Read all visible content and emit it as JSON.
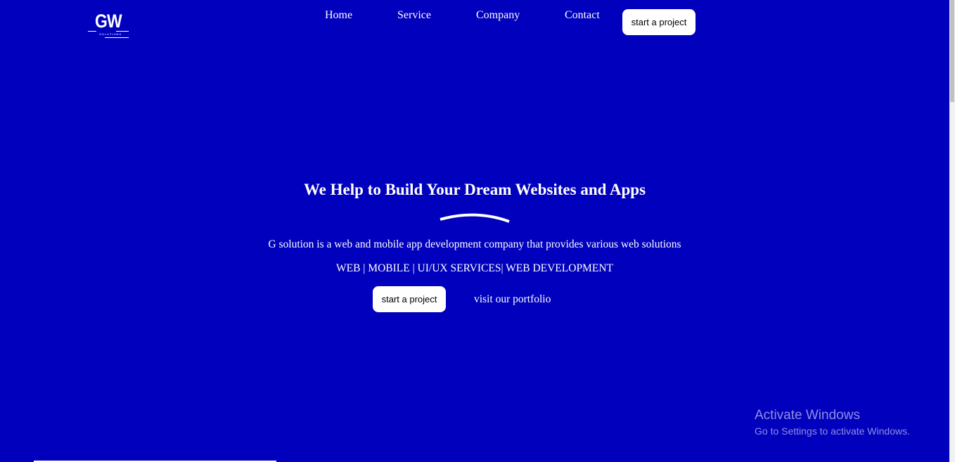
{
  "logo": {
    "letters": "GW",
    "subtitle": "SOLUTIONS"
  },
  "nav": {
    "items": [
      {
        "label": "Home"
      },
      {
        "label": "Service"
      },
      {
        "label": "Company"
      },
      {
        "label": "Contact"
      }
    ],
    "cta_label": "start a project"
  },
  "hero": {
    "title": "We Help to Build Your Dream Websites and Apps",
    "description": "G solution is a web and mobile app development company that provides various web solutions",
    "services": "WEB | MOBILE | UI/UX SERVICES| WEB DEVELOPMENT",
    "cta_label": "start a project",
    "portfolio_label": "visit our portfolio"
  },
  "watermark": {
    "title": "Activate Windows",
    "subtitle": "Go to Settings to activate Windows."
  },
  "colors": {
    "background": "#0000bd",
    "button_bg": "#ffffff",
    "text": "#ffffff"
  }
}
